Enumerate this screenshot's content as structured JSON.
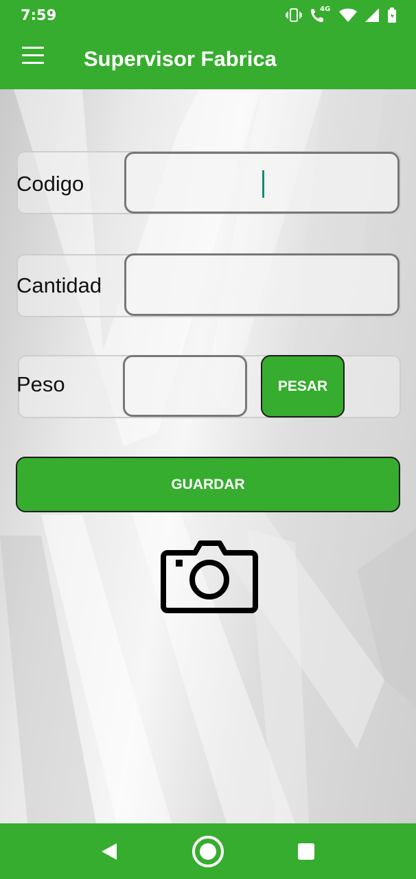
{
  "status_bar": {
    "time": "7:59",
    "network_label": "4G",
    "icons": [
      "vibrate-icon",
      "wifi-calling-icon",
      "wifi-icon",
      "signal-icon",
      "battery-icon"
    ]
  },
  "app_bar": {
    "title": "Supervisor Fabrica",
    "menu_icon": "hamburger-menu-icon"
  },
  "form": {
    "codigo": {
      "label": "Codigo",
      "value": "",
      "placeholder": ""
    },
    "cantidad": {
      "label": "Cantidad",
      "value": "",
      "placeholder": ""
    },
    "peso": {
      "label": "Peso",
      "value": "",
      "placeholder": ""
    },
    "pesar_label": "PESAR",
    "guardar_label": "GUARDAR",
    "camera_icon": "camera-icon"
  },
  "nav_bar": {
    "icons": [
      "back-icon",
      "home-icon",
      "recents-icon"
    ]
  },
  "colors": {
    "primary": "#36ad2e",
    "caret": "#0f8b75"
  }
}
